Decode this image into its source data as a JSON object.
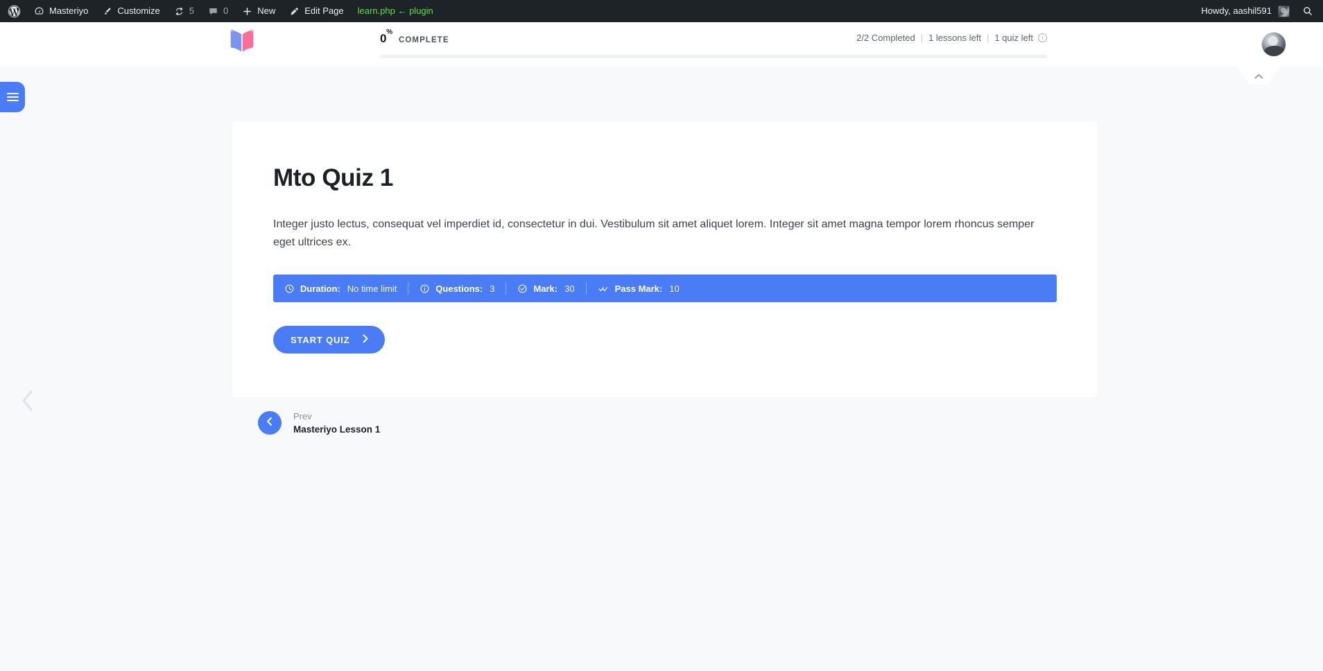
{
  "colors": {
    "accent": "#4a7cf6",
    "adminbar_bg": "#1d2327",
    "page_bg": "#f7f9fb",
    "card_bg": "#ffffff",
    "plugin_link": "#5fe04f",
    "logo_blue": "#7a95ee",
    "logo_pink": "#fa6e97"
  },
  "adminbar": {
    "wp_logo": "wordpress-icon",
    "items": [
      {
        "label": "Masteriyo",
        "icon": "dashboard-icon"
      },
      {
        "label": "Customize",
        "icon": "paintbrush-icon"
      },
      {
        "label": "5",
        "icon": "updates-icon"
      },
      {
        "label": "0",
        "icon": "comment-icon"
      },
      {
        "label": "New",
        "icon": "plus-icon"
      },
      {
        "label": "Edit Page",
        "icon": "pencil-icon"
      }
    ],
    "plugin_notice": "learn.php ← plugin",
    "greeting": "Howdy, aashil591",
    "search_icon": "search-icon"
  },
  "course_header": {
    "logo": "open-book-logo",
    "progress": {
      "percent": "0",
      "percent_symbol": "%",
      "label": "COMPLETE",
      "value": 0
    },
    "status": {
      "completed": "2/2 Completed",
      "lessons_left": "1 lessons left",
      "quiz_left": "1 quiz left",
      "separator": "|",
      "info_icon": "info-icon"
    },
    "avatar": "user-avatar"
  },
  "page_controls": {
    "sidebar_toggle": "hamburger-menu-icon",
    "collapse_chevron": "chevron-up-icon",
    "edge_prev": "chevron-left-icon"
  },
  "quiz": {
    "title": "Mto Quiz 1",
    "description": "Integer justo lectus, consequat vel imperdiet id, consectetur in dui. Vestibulum sit amet aliquet lorem. Integer sit amet magna tempor lorem rhoncus semper eget ultrices ex.",
    "info": [
      {
        "icon": "clock-icon",
        "label": "Duration:",
        "value": "No time limit"
      },
      {
        "icon": "info-circle-icon",
        "label": "Questions:",
        "value": "3"
      },
      {
        "icon": "check-circle-icon",
        "label": "Mark:",
        "value": "30"
      },
      {
        "icon": "double-check-icon",
        "label": "Pass Mark:",
        "value": "10"
      }
    ],
    "start_button": "START QUIZ",
    "start_button_icon": "chevron-right-icon"
  },
  "prev_nav": {
    "icon": "chevron-left-icon",
    "kicker": "Prev",
    "title": "Masteriyo Lesson 1"
  }
}
